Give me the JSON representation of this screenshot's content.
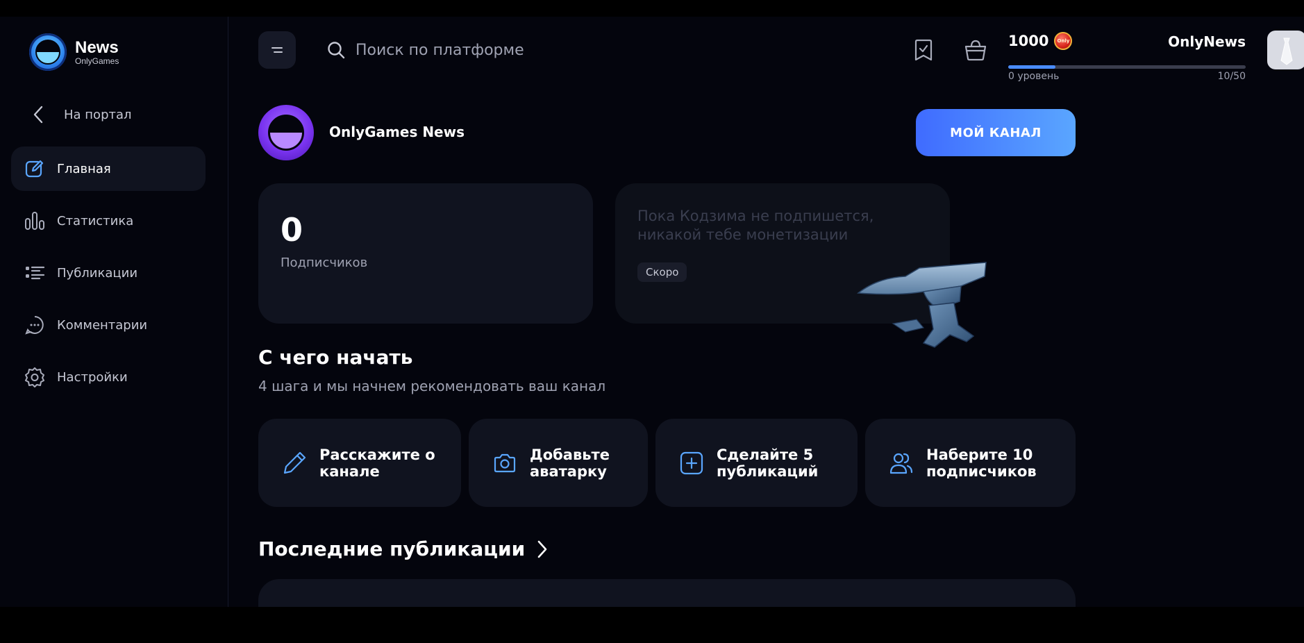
{
  "app": {
    "logo_title": "News",
    "logo_subtitle": "OnlyGames"
  },
  "sidebar": {
    "back_label": "На портал",
    "items": [
      {
        "label": "Главная",
        "icon": "edit-icon",
        "active": true
      },
      {
        "label": "Статистика",
        "icon": "bar-chart-icon",
        "active": false
      },
      {
        "label": "Публикации",
        "icon": "list-icon",
        "active": false
      },
      {
        "label": "Комментарии",
        "icon": "comment-icon",
        "active": false
      },
      {
        "label": "Настройки",
        "icon": "gear-icon",
        "active": false
      }
    ]
  },
  "header": {
    "search_placeholder": "Поиск по платформе",
    "coins": "1000",
    "username": "OnlyNews",
    "level_label": "0 уровень",
    "level_progress_text": "10/50",
    "level_progress_fraction": 0.2
  },
  "channel": {
    "name": "OnlyGames News",
    "my_channel_button": "МОЙ КАНАЛ"
  },
  "stats": {
    "subscribers_count": "0",
    "subscribers_label": "Подписчиков"
  },
  "promo": {
    "text": "Пока Кодзима не подпишется, никакой тебе монетизации",
    "badge": "Скоро"
  },
  "getting_started": {
    "title": "С чего начать",
    "subtitle": "4 шага и мы начнем рекомендовать ваш канал",
    "steps": [
      {
        "label": "Расскажите о канале",
        "icon": "pencil-icon"
      },
      {
        "label": "Добавьте аватарку",
        "icon": "camera-icon"
      },
      {
        "label": "Сделайте 5 публикаций",
        "icon": "plus-square-icon"
      },
      {
        "label": "Наберите 10 подписчиков",
        "icon": "users-icon"
      }
    ]
  },
  "latest": {
    "title": "Последние публикации"
  },
  "colors": {
    "background": "#04050d",
    "card": "#10131f",
    "accent_blue": "#4a8cff",
    "icon_blue": "#5aa6ff",
    "muted_text": "#9fa2b2"
  }
}
